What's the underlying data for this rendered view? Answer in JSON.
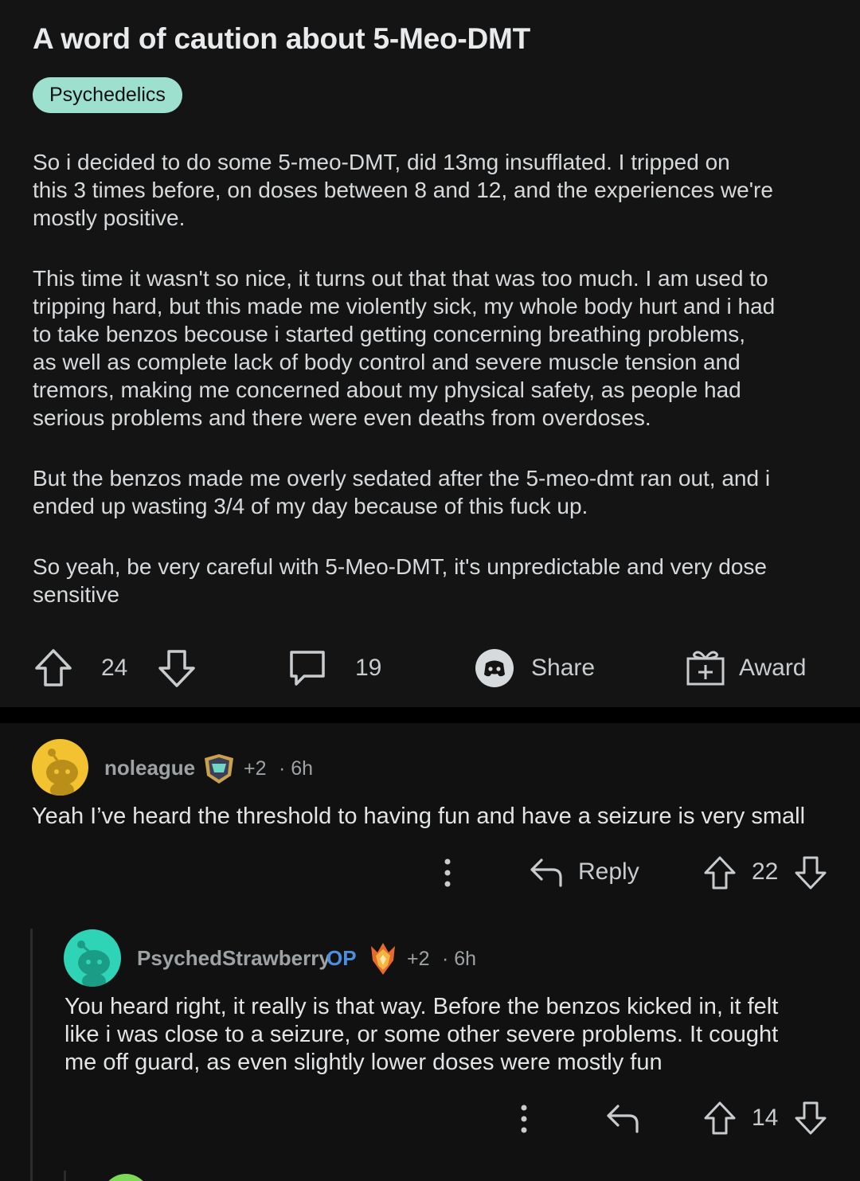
{
  "post": {
    "title": "A word of caution about 5-Meo-DMT",
    "flair": "Psychedelics",
    "paragraphs": [
      "So i decided to do some 5-meo-DMT, did 13mg insufflated. I tripped on\nthis 3 times before, on doses between 8 and 12, and the experiences we're\nmostly positive.",
      "This time it wasn't so nice, it turns out that that was too much. I am used to\ntripping hard, but this made me violently sick, my whole body hurt and i had\nto take benzos becouse i started getting concerning breathing problems,\nas well as complete lack of body control and severe muscle tension and\ntremors, making me concerned about my physical safety, as people had\nserious problems and there were even deaths from overdoses.",
      "But the benzos made me overly sedated after the 5-meo-dmt ran out, and i\nended up wasting 3/4 of my day because of this fuck up.",
      "So yeah, be very careful with 5-Meo-DMT, it's unpredictable and very dose\nsensitive"
    ],
    "actions": {
      "score": "24",
      "comments": "19",
      "share_label": "Share",
      "award_label": "Award"
    }
  },
  "comments": [
    {
      "username": "noleague",
      "karma": "+2",
      "time": "· 6h",
      "text": "Yeah I’ve heard the threshold to having fun and have a seizure is very small",
      "reply_label": "Reply",
      "score": "22",
      "avatar_color": "#f2c230"
    },
    {
      "username": "PsychedStrawberry",
      "op_label": "OP",
      "karma": "+2",
      "time": "· 6h",
      "text": "You heard right, it really is that way. Before the benzos kicked in, it felt\nlike i was close to a seizure, or some other severe problems. It cought\nme off guard, as even slightly lower doses were mostly fun",
      "score": "14",
      "avatar_color": "#2fd3b6"
    }
  ],
  "colors": {
    "flair_bg": "#9ee0ce",
    "op_blue": "#4a90e2",
    "background": "#111111"
  }
}
